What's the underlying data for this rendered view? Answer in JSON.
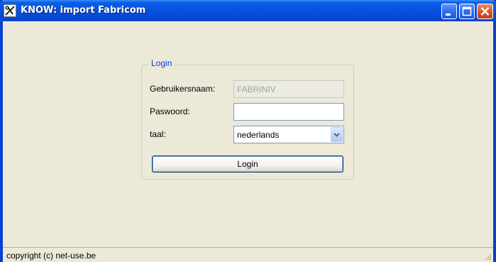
{
  "window": {
    "title": "KNOW: import Fabricom",
    "icon": "scissors-app-icon",
    "controls": [
      "minimize-icon",
      "maximize-icon",
      "close-icon"
    ]
  },
  "login_group": {
    "legend": "Login",
    "username_label": "Gebruikersnaam:",
    "username_value": "FABRINIV",
    "password_label": "Paswoord:",
    "password_value": "",
    "language_label": "taal:",
    "language_selected": "nederlands",
    "submit_label": "Login"
  },
  "statusbar": {
    "text": "copyright (c) net-use.be"
  },
  "colors": {
    "titlebar": "#0653e0",
    "window_bg": "#ece9d8",
    "legend_text": "#0046d5",
    "close_button": "#d65a32"
  }
}
